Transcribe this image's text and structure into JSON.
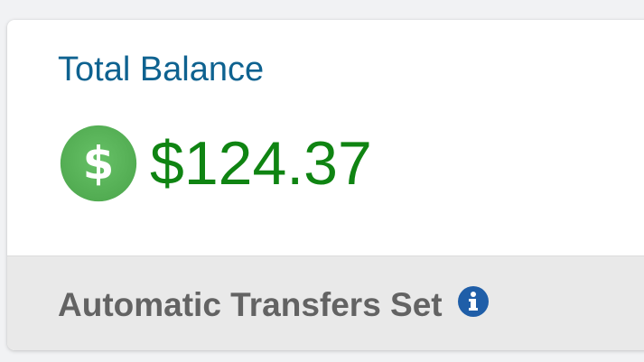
{
  "balance_card": {
    "title": "Total Balance",
    "amount": "$124.37",
    "currency_icon": "dollar-circle-icon",
    "footer": {
      "text": "Automatic Transfers Set",
      "info_icon": "info-icon"
    }
  },
  "colors": {
    "title": "#0e6290",
    "amount": "#0f8412",
    "icon_green": "#5cb85c",
    "footer_bg": "#e9e9e9",
    "footer_text": "#636363",
    "info_blue": "#1f5ea8"
  }
}
